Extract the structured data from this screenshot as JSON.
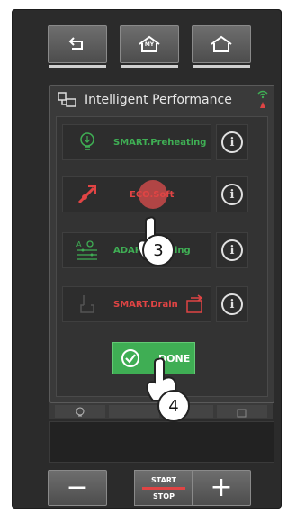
{
  "top_nav": {
    "back": "back",
    "home_my": "MY",
    "home": "home"
  },
  "panel": {
    "title": "Intelligent Performance"
  },
  "rows": [
    {
      "label": "SMART.Preheating",
      "color": "#3fae54"
    },
    {
      "label": "ECO.Soft",
      "color": "#e04444"
    },
    {
      "label": "ADAPT.Cooking",
      "color": "#3fae54"
    },
    {
      "label": "SMART.Drain",
      "color": "#e04444"
    }
  ],
  "info_symbol": "i",
  "done_label": "DONE",
  "markers": [
    "3",
    "4"
  ],
  "bottom": {
    "minus": "−",
    "start": "START",
    "stop": "STOP",
    "plus": "+"
  },
  "colors": {
    "accent_green": "#3fae54",
    "accent_red": "#e04444"
  }
}
